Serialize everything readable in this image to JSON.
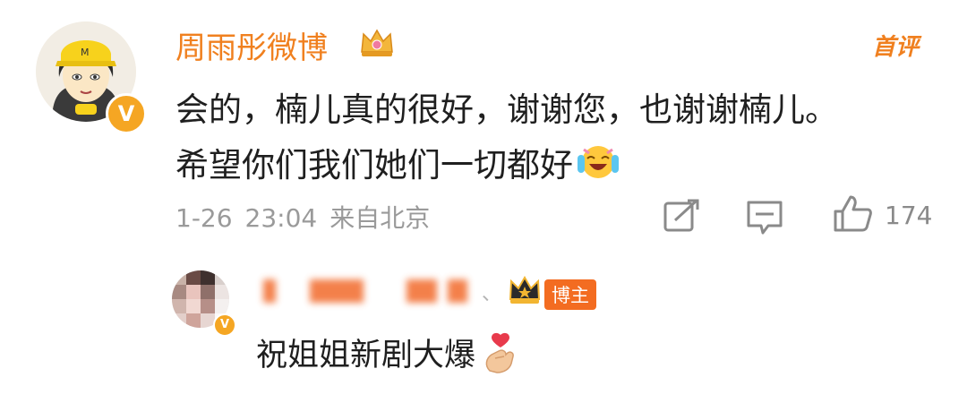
{
  "comment": {
    "username": "周雨彤微博",
    "badge": "首评",
    "text_line1": "会的，楠儿真的很好，谢谢您，也谢谢楠儿。",
    "text_line2": "希望你们我们她们一切都好",
    "emoji": "laughing-tears-icon",
    "date": "1-26",
    "time": "23:04",
    "location": "来自北京",
    "likes": "174",
    "verified_mark": "V"
  },
  "reply": {
    "separator": "、",
    "owner_label": "博主",
    "text": "祝姐姐新剧大爆",
    "emoji": "finger-heart-icon"
  },
  "colors": {
    "accent": "#f0801f",
    "text": "#1f1f1f",
    "meta": "#9a9a9a",
    "owner_badge": "#f36c21"
  }
}
